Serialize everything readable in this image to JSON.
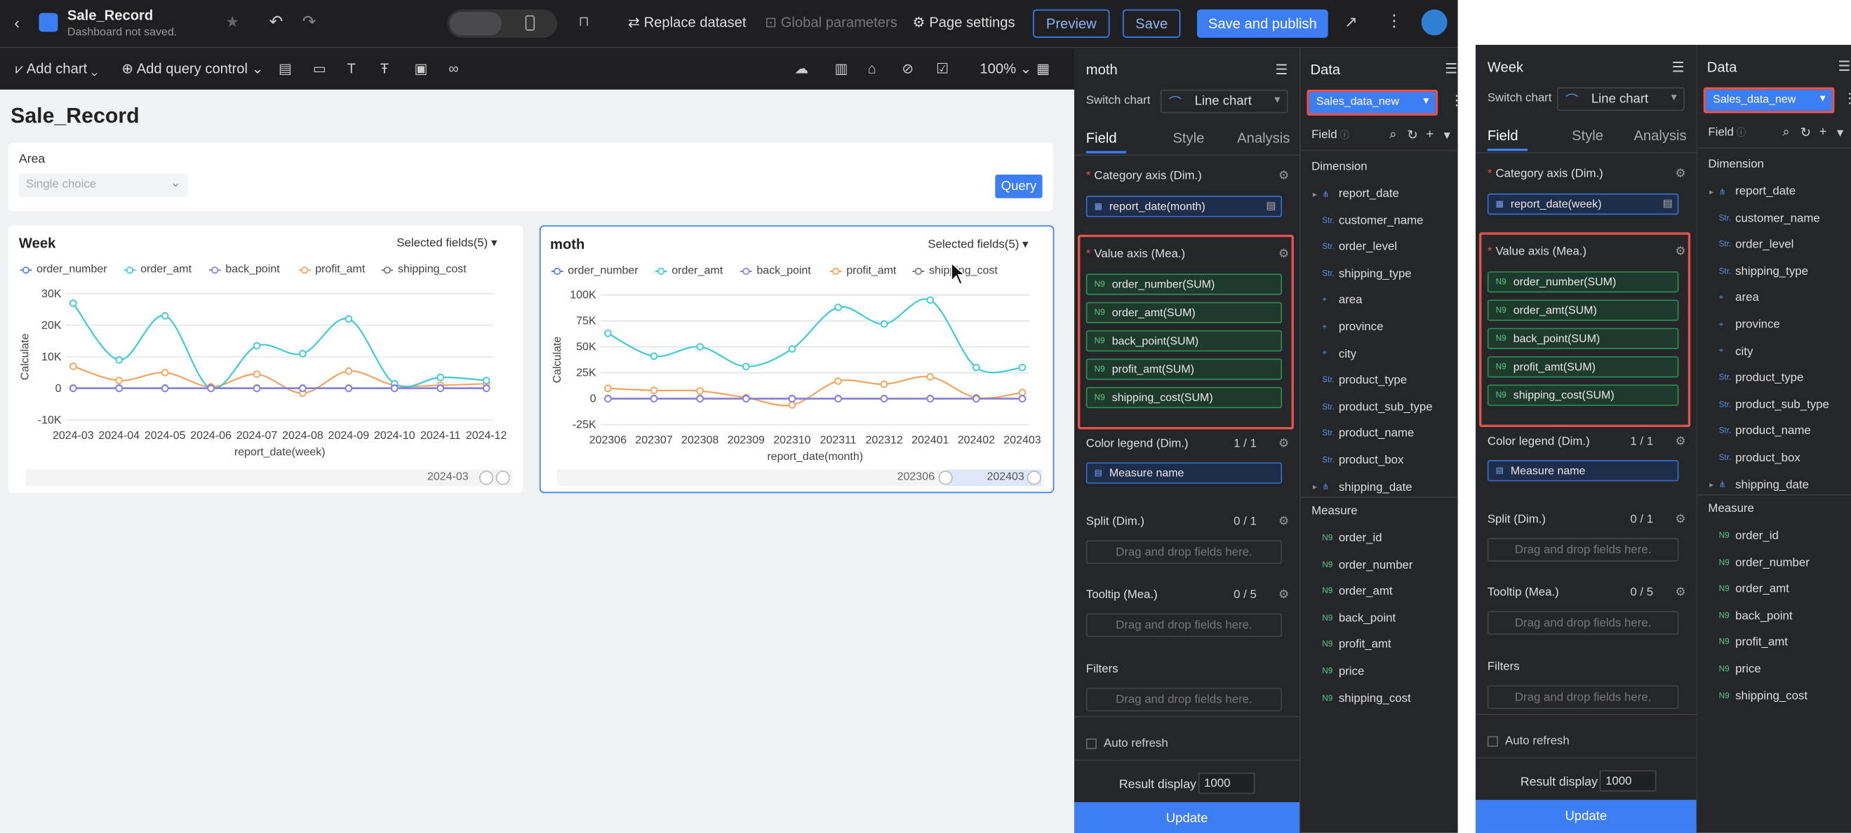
{
  "topbar": {
    "title": "Sale_Record",
    "subtitle": "Dashboard not saved.",
    "replace_dataset": "Replace dataset",
    "global_params": "Global parameters",
    "page_settings": "Page settings",
    "preview": "Preview",
    "save": "Save",
    "save_publish": "Save and publish"
  },
  "toolbar": {
    "add_chart": "Add chart",
    "add_query": "Add query control",
    "zoom": "100%"
  },
  "canvas": {
    "page_title": "Sale_Record",
    "area_label": "Area",
    "area_placeholder": "Single choice",
    "query": "Query"
  },
  "colors": {
    "order_number": "#5b7fd9",
    "order_amt": "#3fcad6",
    "back_point": "#8b7fd9",
    "profit_amt": "#f3a35f",
    "shipping_cost": "#777777",
    "accent": "#3d7ef5",
    "red": "#e5534b"
  },
  "charts": [
    {
      "title": "Week",
      "selected": "Selected fields(5)",
      "legend": [
        "order_number",
        "order_amt",
        "back_point",
        "profit_amt",
        "shipping_cost"
      ],
      "ylabel": "Calculate",
      "xlabel": "report_date(week)",
      "yticks": [
        "30K",
        "20K",
        "10K",
        "0",
        "-10K"
      ],
      "xticks": [
        "2024-03",
        "2024-04",
        "2024-05",
        "2024-06",
        "2024-07",
        "2024-08",
        "2024-09",
        "2024-10",
        "2024-11",
        "2024-12"
      ],
      "slider_label": "2024-03"
    },
    {
      "title": "moth",
      "selected": "Selected fields(5)",
      "legend": [
        "order_number",
        "order_amt",
        "back_point",
        "profit_amt",
        "shipping_cost"
      ],
      "ylabel": "Calculate",
      "xlabel": "report_date(month)",
      "yticks": [
        "100K",
        "75K",
        "50K",
        "25K",
        "0",
        "-25K"
      ],
      "xticks": [
        "202306",
        "202307",
        "202308",
        "202309",
        "202310",
        "202311",
        "202312",
        "202401",
        "202402",
        "202403"
      ],
      "slider_left": "202306",
      "slider_right": "202403"
    }
  ],
  "chart_data": [
    {
      "type": "line",
      "title": "Week",
      "categories": [
        "2024-03",
        "2024-04",
        "2024-05",
        "2024-06",
        "2024-07",
        "2024-08",
        "2024-09",
        "2024-10",
        "2024-11",
        "2024-12"
      ],
      "ylim": [
        -10000,
        30000
      ],
      "series": [
        {
          "name": "order_number",
          "values": [
            100,
            100,
            100,
            100,
            100,
            100,
            100,
            100,
            100,
            100
          ]
        },
        {
          "name": "order_amt",
          "values": [
            27000,
            9000,
            23000,
            0,
            13500,
            11000,
            22000,
            1500,
            3500,
            2500
          ]
        },
        {
          "name": "back_point",
          "values": [
            0,
            0,
            0,
            0,
            0,
            0,
            0,
            0,
            0,
            0
          ]
        },
        {
          "name": "profit_amt",
          "values": [
            7000,
            2500,
            5000,
            500,
            4500,
            -1500,
            5500,
            1000,
            1000,
            1500
          ]
        },
        {
          "name": "shipping_cost",
          "values": [
            0,
            0,
            0,
            0,
            0,
            0,
            0,
            0,
            0,
            0
          ]
        }
      ]
    },
    {
      "type": "line",
      "title": "moth",
      "categories": [
        "202306",
        "202307",
        "202308",
        "202309",
        "202310",
        "202311",
        "202312",
        "202401",
        "202402",
        "202403"
      ],
      "ylim": [
        -25000,
        100000
      ],
      "series": [
        {
          "name": "order_number",
          "values": [
            200,
            200,
            200,
            200,
            200,
            200,
            200,
            200,
            200,
            200
          ]
        },
        {
          "name": "order_amt",
          "values": [
            63000,
            41000,
            50000,
            31000,
            48000,
            88000,
            72000,
            95000,
            30000,
            30000
          ]
        },
        {
          "name": "back_point",
          "values": [
            0,
            0,
            0,
            0,
            0,
            0,
            0,
            0,
            0,
            0
          ]
        },
        {
          "name": "profit_amt",
          "values": [
            10000,
            8000,
            7500,
            1000,
            -6000,
            17000,
            14000,
            21000,
            1000,
            6000
          ]
        },
        {
          "name": "shipping_cost",
          "values": [
            0,
            0,
            0,
            0,
            0,
            0,
            0,
            0,
            0,
            0
          ]
        }
      ]
    }
  ],
  "config": [
    {
      "chart_name": "moth",
      "switch_label": "Switch chart",
      "chart_type": "Line chart",
      "tabs": [
        "Field",
        "Style",
        "Analysis"
      ],
      "category_label": "Category axis (Dim.)",
      "category_field": "report_date(month)",
      "value_label": "Value axis (Mea.)",
      "values": [
        "order_number(SUM)",
        "order_amt(SUM)",
        "back_point(SUM)",
        "profit_amt(SUM)",
        "shipping_cost(SUM)"
      ],
      "legend_label": "Color legend (Dim.)",
      "legend_count": "1 / 1",
      "legend_field": "Measure name",
      "split_label": "Split (Dim.)",
      "split_count": "0 / 1",
      "drop": "Drag and drop fields here.",
      "tooltip_label": "Tooltip (Mea.)",
      "tooltip_count": "0 / 5",
      "filters_label": "Filters",
      "auto_refresh": "Auto refresh",
      "result_label": "Result display",
      "result_value": "1000",
      "update": "Update"
    },
    {
      "chart_name": "Week",
      "switch_label": "Switch chart",
      "chart_type": "Line chart",
      "tabs": [
        "Field",
        "Style",
        "Analysis"
      ],
      "category_label": "Category axis (Dim.)",
      "category_field": "report_date(week)",
      "value_label": "Value axis (Mea.)",
      "values": [
        "order_number(SUM)",
        "order_amt(SUM)",
        "back_point(SUM)",
        "profit_amt(SUM)",
        "shipping_cost(SUM)"
      ],
      "legend_label": "Color legend (Dim.)",
      "legend_count": "1 / 1",
      "legend_field": "Measure name",
      "split_label": "Split (Dim.)",
      "split_count": "0 / 1",
      "drop": "Drag and drop fields here.",
      "tooltip_label": "Tooltip (Mea.)",
      "tooltip_count": "0 / 5",
      "filters_label": "Filters",
      "auto_refresh": "Auto refresh",
      "result_label": "Result display",
      "result_value": "1000",
      "update": "Update"
    }
  ],
  "data_panel": {
    "title": "Data",
    "dataset": "Sales_data_new",
    "field_label": "Field",
    "dimension": "Dimension",
    "measure": "Measure",
    "dims": [
      {
        "n": "report_date",
        "t": "date"
      },
      {
        "n": "customer_name",
        "t": "Str."
      },
      {
        "n": "order_level",
        "t": "Str."
      },
      {
        "n": "shipping_type",
        "t": "Str."
      },
      {
        "n": "area",
        "t": "geo"
      },
      {
        "n": "province",
        "t": "geo"
      },
      {
        "n": "city",
        "t": "geo"
      },
      {
        "n": "product_type",
        "t": "Str."
      },
      {
        "n": "product_sub_type",
        "t": "Str."
      },
      {
        "n": "product_name",
        "t": "Str."
      },
      {
        "n": "product_box",
        "t": "Str."
      },
      {
        "n": "shipping_date",
        "t": "date"
      }
    ],
    "measures": [
      "order_id",
      "order_number",
      "order_amt",
      "back_point",
      "profit_amt",
      "price",
      "shipping_cost"
    ]
  }
}
